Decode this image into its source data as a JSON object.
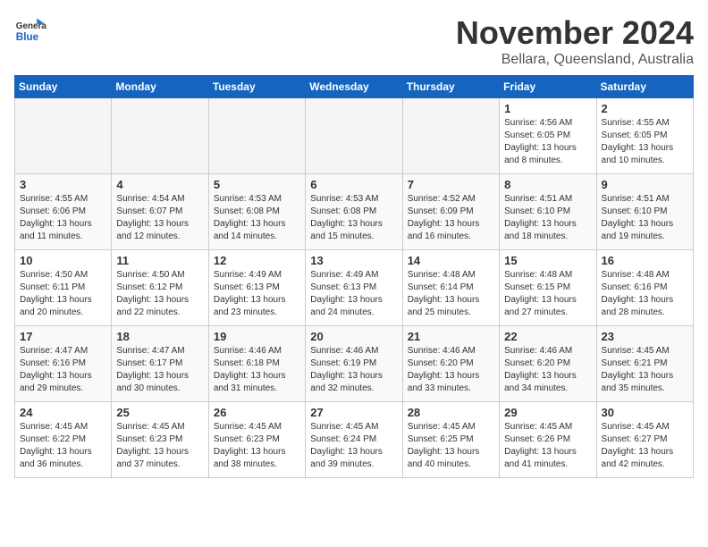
{
  "logo": {
    "line1": "General",
    "line2": "Blue"
  },
  "title": "November 2024",
  "location": "Bellara, Queensland, Australia",
  "days_header": [
    "Sunday",
    "Monday",
    "Tuesday",
    "Wednesday",
    "Thursday",
    "Friday",
    "Saturday"
  ],
  "weeks": [
    [
      {
        "num": "",
        "info": ""
      },
      {
        "num": "",
        "info": ""
      },
      {
        "num": "",
        "info": ""
      },
      {
        "num": "",
        "info": ""
      },
      {
        "num": "",
        "info": ""
      },
      {
        "num": "1",
        "info": "Sunrise: 4:56 AM\nSunset: 6:05 PM\nDaylight: 13 hours\nand 8 minutes."
      },
      {
        "num": "2",
        "info": "Sunrise: 4:55 AM\nSunset: 6:05 PM\nDaylight: 13 hours\nand 10 minutes."
      }
    ],
    [
      {
        "num": "3",
        "info": "Sunrise: 4:55 AM\nSunset: 6:06 PM\nDaylight: 13 hours\nand 11 minutes."
      },
      {
        "num": "4",
        "info": "Sunrise: 4:54 AM\nSunset: 6:07 PM\nDaylight: 13 hours\nand 12 minutes."
      },
      {
        "num": "5",
        "info": "Sunrise: 4:53 AM\nSunset: 6:08 PM\nDaylight: 13 hours\nand 14 minutes."
      },
      {
        "num": "6",
        "info": "Sunrise: 4:53 AM\nSunset: 6:08 PM\nDaylight: 13 hours\nand 15 minutes."
      },
      {
        "num": "7",
        "info": "Sunrise: 4:52 AM\nSunset: 6:09 PM\nDaylight: 13 hours\nand 16 minutes."
      },
      {
        "num": "8",
        "info": "Sunrise: 4:51 AM\nSunset: 6:10 PM\nDaylight: 13 hours\nand 18 minutes."
      },
      {
        "num": "9",
        "info": "Sunrise: 4:51 AM\nSunset: 6:10 PM\nDaylight: 13 hours\nand 19 minutes."
      }
    ],
    [
      {
        "num": "10",
        "info": "Sunrise: 4:50 AM\nSunset: 6:11 PM\nDaylight: 13 hours\nand 20 minutes."
      },
      {
        "num": "11",
        "info": "Sunrise: 4:50 AM\nSunset: 6:12 PM\nDaylight: 13 hours\nand 22 minutes."
      },
      {
        "num": "12",
        "info": "Sunrise: 4:49 AM\nSunset: 6:13 PM\nDaylight: 13 hours\nand 23 minutes."
      },
      {
        "num": "13",
        "info": "Sunrise: 4:49 AM\nSunset: 6:13 PM\nDaylight: 13 hours\nand 24 minutes."
      },
      {
        "num": "14",
        "info": "Sunrise: 4:48 AM\nSunset: 6:14 PM\nDaylight: 13 hours\nand 25 minutes."
      },
      {
        "num": "15",
        "info": "Sunrise: 4:48 AM\nSunset: 6:15 PM\nDaylight: 13 hours\nand 27 minutes."
      },
      {
        "num": "16",
        "info": "Sunrise: 4:48 AM\nSunset: 6:16 PM\nDaylight: 13 hours\nand 28 minutes."
      }
    ],
    [
      {
        "num": "17",
        "info": "Sunrise: 4:47 AM\nSunset: 6:16 PM\nDaylight: 13 hours\nand 29 minutes."
      },
      {
        "num": "18",
        "info": "Sunrise: 4:47 AM\nSunset: 6:17 PM\nDaylight: 13 hours\nand 30 minutes."
      },
      {
        "num": "19",
        "info": "Sunrise: 4:46 AM\nSunset: 6:18 PM\nDaylight: 13 hours\nand 31 minutes."
      },
      {
        "num": "20",
        "info": "Sunrise: 4:46 AM\nSunset: 6:19 PM\nDaylight: 13 hours\nand 32 minutes."
      },
      {
        "num": "21",
        "info": "Sunrise: 4:46 AM\nSunset: 6:20 PM\nDaylight: 13 hours\nand 33 minutes."
      },
      {
        "num": "22",
        "info": "Sunrise: 4:46 AM\nSunset: 6:20 PM\nDaylight: 13 hours\nand 34 minutes."
      },
      {
        "num": "23",
        "info": "Sunrise: 4:45 AM\nSunset: 6:21 PM\nDaylight: 13 hours\nand 35 minutes."
      }
    ],
    [
      {
        "num": "24",
        "info": "Sunrise: 4:45 AM\nSunset: 6:22 PM\nDaylight: 13 hours\nand 36 minutes."
      },
      {
        "num": "25",
        "info": "Sunrise: 4:45 AM\nSunset: 6:23 PM\nDaylight: 13 hours\nand 37 minutes."
      },
      {
        "num": "26",
        "info": "Sunrise: 4:45 AM\nSunset: 6:23 PM\nDaylight: 13 hours\nand 38 minutes."
      },
      {
        "num": "27",
        "info": "Sunrise: 4:45 AM\nSunset: 6:24 PM\nDaylight: 13 hours\nand 39 minutes."
      },
      {
        "num": "28",
        "info": "Sunrise: 4:45 AM\nSunset: 6:25 PM\nDaylight: 13 hours\nand 40 minutes."
      },
      {
        "num": "29",
        "info": "Sunrise: 4:45 AM\nSunset: 6:26 PM\nDaylight: 13 hours\nand 41 minutes."
      },
      {
        "num": "30",
        "info": "Sunrise: 4:45 AM\nSunset: 6:27 PM\nDaylight: 13 hours\nand 42 minutes."
      }
    ]
  ]
}
